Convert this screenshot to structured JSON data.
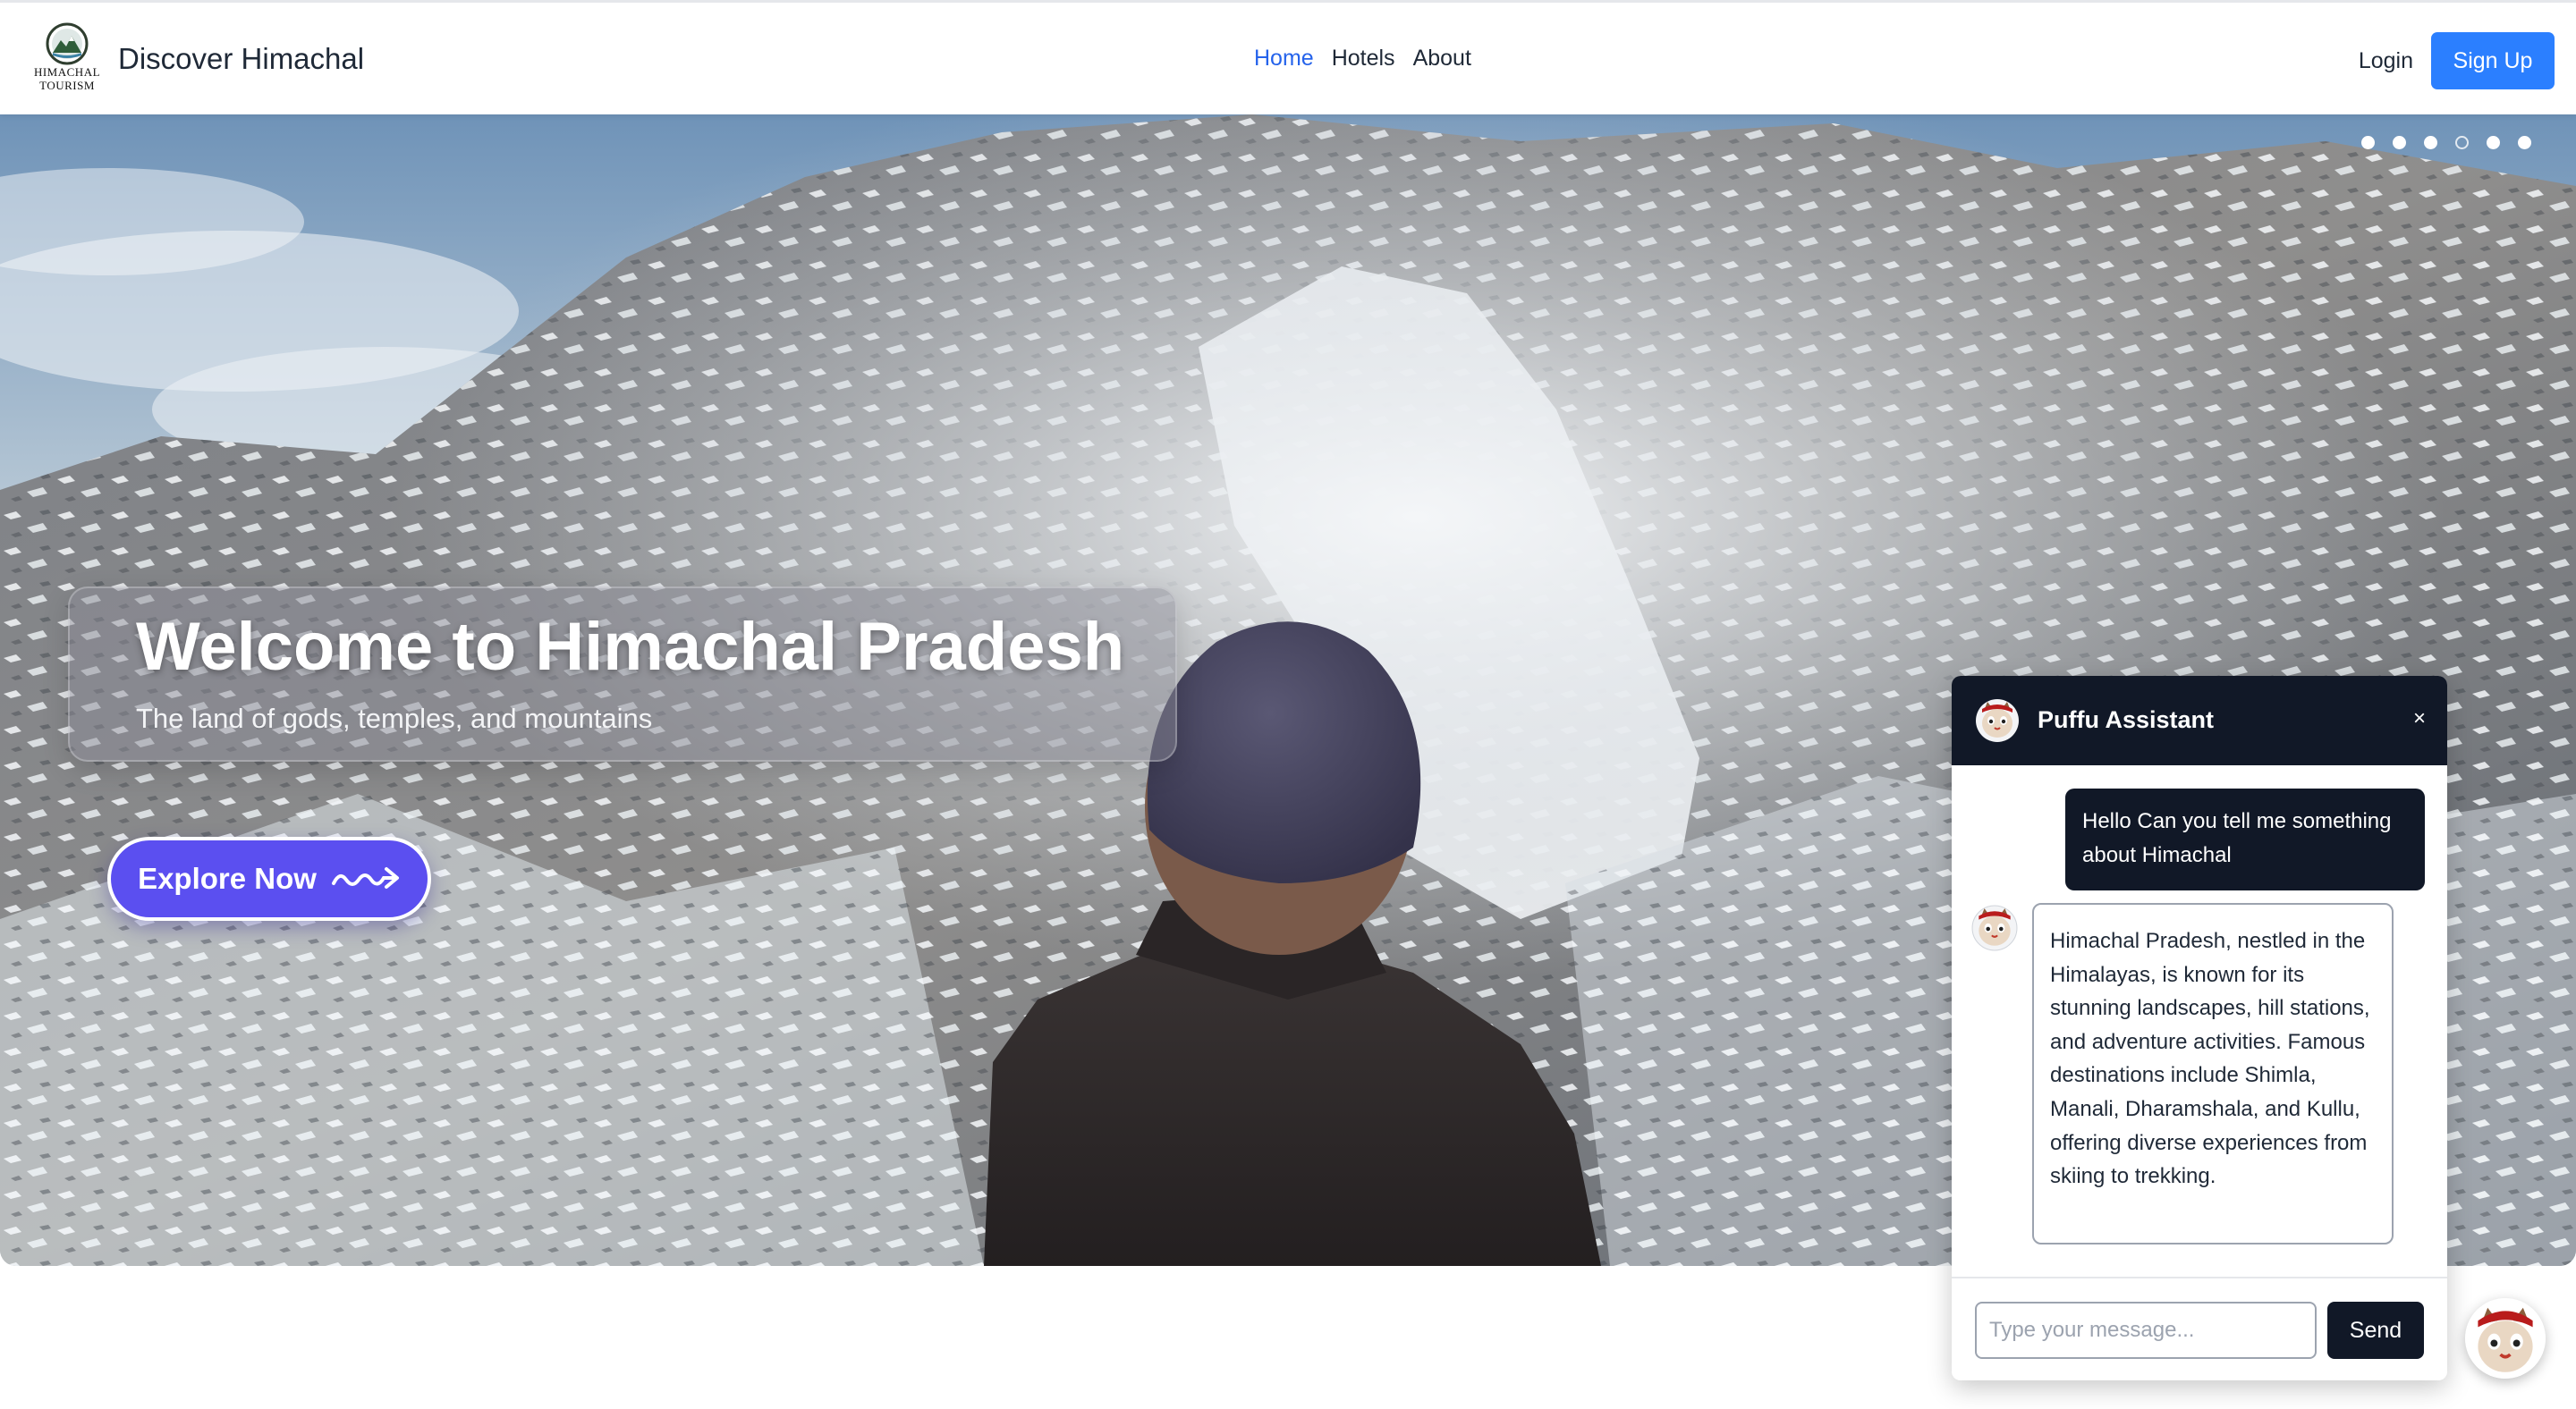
{
  "navbar": {
    "logo_text": [
      "HIMACHAL",
      "TOURISM"
    ],
    "brand_name": "Discover Himachal",
    "links": [
      {
        "label": "Home",
        "active": true
      },
      {
        "label": "Hotels",
        "active": false
      },
      {
        "label": "About",
        "active": false
      }
    ],
    "login_label": "Login",
    "signup_label": "Sign Up",
    "accent_color": "#2b7fff"
  },
  "hero": {
    "title": "Welcome to Himachal Pradesh",
    "subtitle": "The land of gods, temples, and mountains",
    "cta_label": "Explore Now",
    "cta_icon": "squiggle-arrow-icon",
    "carousel": {
      "slide_count": 6,
      "active_index": 3
    }
  },
  "chat": {
    "title": "Puffu Assistant",
    "close_label": "×",
    "messages": [
      {
        "role": "user",
        "text": "Hello Can you tell me something about Himachal"
      },
      {
        "role": "bot",
        "text": "Himachal Pradesh, nestled in the Himalayas, is known for its stunning landscapes, hill stations, and adventure activities. Famous destinations include Shimla, Manali, Dharamshala, and Kullu, offering diverse experiences from skiing to trekking."
      }
    ],
    "input_placeholder": "Type your message...",
    "send_label": "Send",
    "header_color": "#111827"
  }
}
